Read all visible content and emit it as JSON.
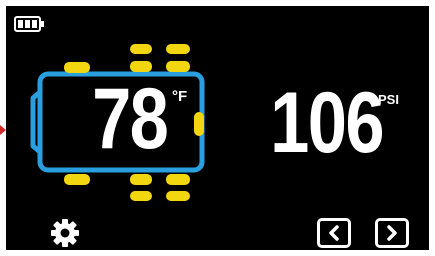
{
  "status": {
    "battery_icon": "battery-full-icon"
  },
  "temperature": {
    "value": "78",
    "unit": "°F"
  },
  "pressure": {
    "value": "106",
    "unit": "PSI"
  },
  "controls": {
    "settings_icon": "gear-icon",
    "prev_icon": "chevron-left-icon",
    "next_icon": "chevron-right-icon"
  },
  "colors": {
    "background": "#000000",
    "frame": "#2a9fe0",
    "tire": "#f2d60f",
    "text": "#ffffff",
    "marker": "#d02a2a"
  }
}
